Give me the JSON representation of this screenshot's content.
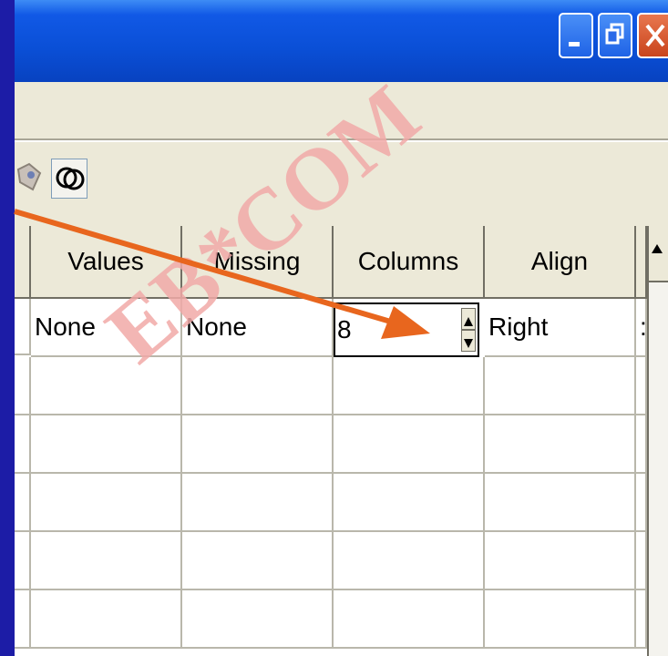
{
  "window": {
    "controls": {
      "minimize_icon": "minimize-icon",
      "restore_icon": "restore-icon",
      "close_icon": "close-icon"
    }
  },
  "toolbar": {
    "icons": [
      "value-labels-icon",
      "use-sets-icon"
    ]
  },
  "grid": {
    "columns": [
      "Values",
      "Missing",
      "Columns",
      "Align"
    ],
    "rows": [
      {
        "values": "None",
        "missing": "None",
        "columns": "8",
        "align": "Right",
        "next": ":"
      }
    ]
  },
  "watermark": {
    "text": "EB*COM",
    "color": "#e53935"
  },
  "annotation": {
    "arrow_color": "#e8661e"
  },
  "colors": {
    "desktop": "#1c1ca6",
    "titlebar": "#0a4fd6",
    "close": "#c9451d"
  }
}
